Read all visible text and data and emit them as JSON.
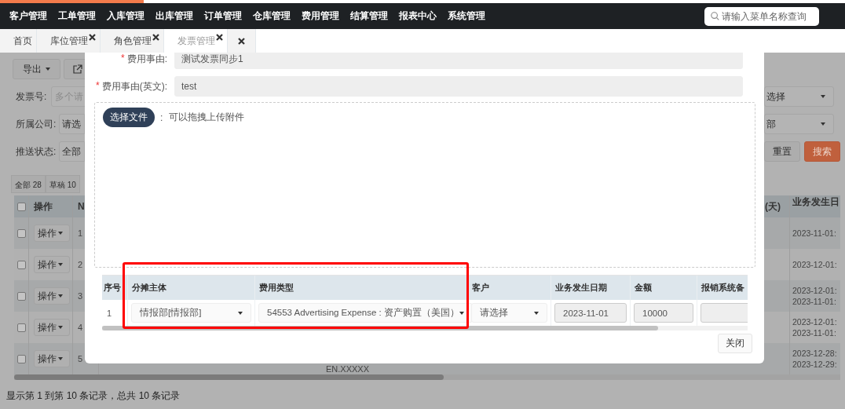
{
  "loading_bar": {
    "level": 0.17
  },
  "nav": {
    "items": [
      "客户管理",
      "工单管理",
      "入库管理",
      "出库管理",
      "订单管理",
      "仓库管理",
      "费用管理",
      "结算管理",
      "报表中心",
      "系统管理"
    ],
    "search": {
      "placeholder": "请输入菜单名称查询"
    }
  },
  "tabs": [
    {
      "label": "首页",
      "selected": false,
      "closable": false
    },
    {
      "label": "库位管理",
      "selected": false,
      "closable": true
    },
    {
      "label": "角色管理",
      "selected": false,
      "closable": true
    },
    {
      "label": "发票管理",
      "selected": true,
      "closable": true
    },
    {
      "selected": false,
      "closable": true
    }
  ],
  "page": {
    "export_button": "导出",
    "filters_left": [
      {
        "label": "发票号:",
        "kind": "input",
        "placeholder": "多个请"
      },
      {
        "label": "所属公司:",
        "kind": "select",
        "value": "请选"
      },
      {
        "label": "推送状态:",
        "kind": "select",
        "value": "全部"
      }
    ],
    "filters_right": [
      {
        "kind": "select",
        "value": "选择"
      },
      {
        "kind": "select",
        "value": "部"
      },
      {
        "kind": "buttons",
        "buttons": [
          {
            "label": "重置",
            "primary": false
          },
          {
            "label": "搜索",
            "primary": true
          }
        ]
      }
    ],
    "status_tabs": [
      "全部 28",
      "草稿 10"
    ],
    "table": {
      "header_checked": false,
      "columns_left": [
        "操作",
        "N"
      ],
      "columns_right": [
        "(天)",
        "业务发生日"
      ],
      "rows": [
        {
          "checked": false,
          "action": "操作",
          "index": "1",
          "dates": [
            "2023-11-01:"
          ]
        },
        {
          "checked": false,
          "action": "操作",
          "index": "2",
          "dates": [
            "2023-12-01:"
          ]
        },
        {
          "checked": false,
          "action": "操作",
          "index": "3",
          "dates": [
            "2023-12-01:",
            "2023-11-01:"
          ]
        },
        {
          "checked": false,
          "action": "操作",
          "index": "4",
          "dates": [
            "2023-12-01:",
            "2023-11-01:"
          ]
        },
        {
          "checked": false,
          "action": "操作",
          "index": "5",
          "note": "EN.XXXXX",
          "dates": [
            "2023-12-28:",
            "2023-12-29:"
          ]
        }
      ]
    },
    "footer": "显示第 1 到第 10 条记录，总共 10 条记录"
  },
  "dialog": {
    "fields": [
      {
        "mark": "*",
        "label": "费用事由:",
        "value": "测试发票同步1",
        "disabled": true
      },
      {
        "mark": "*",
        "label": "费用事由(英文):",
        "value": "test",
        "disabled": true
      }
    ],
    "upload": {
      "button": "选择文件",
      "separator": ":",
      "hint": "可以拖拽上传附件"
    },
    "table": {
      "columns": [
        "序号",
        "分摊主体",
        "费用类型",
        "客户",
        "业务发生日期",
        "金额",
        "报销系统备"
      ],
      "rows": [
        {
          "cells": [
            {
              "kind": "text",
              "value": "1"
            },
            {
              "kind": "select",
              "value": "情报部[情报部]"
            },
            {
              "kind": "select",
              "value": "54553 Advertising Expense : 资产购置（美国）"
            },
            {
              "kind": "select",
              "value": "请选择"
            },
            {
              "kind": "input",
              "value": "2023-11-01",
              "disabled": true
            },
            {
              "kind": "input",
              "value": "10000",
              "disabled": true
            },
            {
              "kind": "input",
              "disabled": true
            }
          ]
        }
      ]
    },
    "close_button": "关闭"
  }
}
